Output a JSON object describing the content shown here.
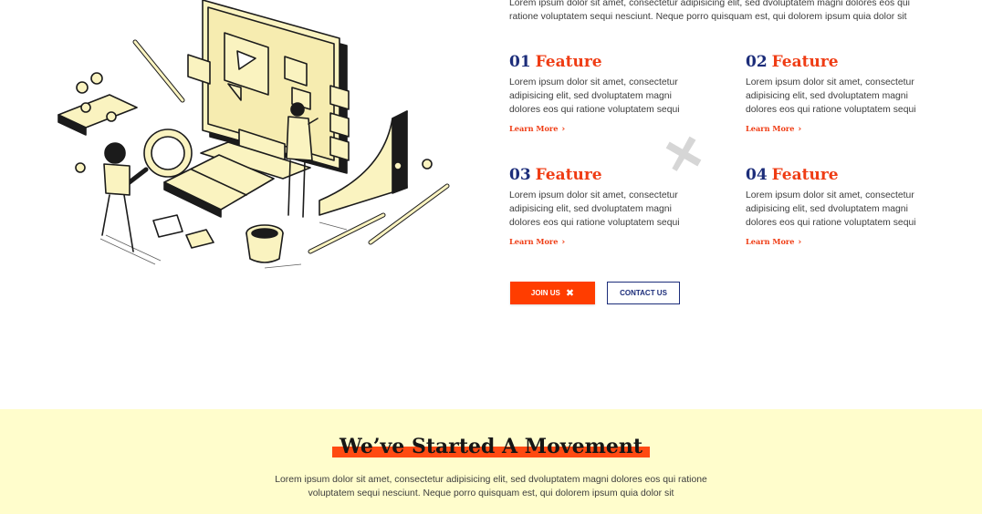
{
  "intro": {
    "text": "Lorem ipsum dolor sit amet, consectetur adipisicing elit, sed dvoluptatem magni dolores eos qui ratione voluptatem sequi nesciunt. Neque porro quisquam est, qui dolorem ipsum quia dolor sit"
  },
  "features": [
    {
      "number": "01",
      "title": "Feature",
      "description": "Lorem ipsum dolor sit amet, consectetur adipisicing elit, sed dvoluptatem magni dolores eos qui ratione voluptatem sequi",
      "link": "Learn More"
    },
    {
      "number": "02",
      "title": "Feature",
      "description": "Lorem ipsum dolor sit amet, consectetur adipisicing elit, sed dvoluptatem magni dolores eos qui ratione voluptatem sequi",
      "link": "Learn More"
    },
    {
      "number": "03",
      "title": "Feature",
      "description": "Lorem ipsum dolor sit amet, consectetur adipisicing elit, sed dvoluptatem magni dolores eos qui ratione voluptatem sequi",
      "link": "Learn More"
    },
    {
      "number": "04",
      "title": "Feature",
      "description": "Lorem ipsum dolor sit amet, consectetur adipisicing elit, sed dvoluptatem magni dolores eos qui ratione voluptatem sequi",
      "link": "Learn More"
    }
  ],
  "buttons": {
    "join": "JOIN US",
    "contact": "CONTACT US"
  },
  "movement": {
    "title": "We’ve Started A Movement",
    "text": "Lorem ipsum dolor sit amet, consectetur adipisicing elit, sed dvoluptatem magni dolores eos qui ratione voluptatem sequi nesciunt. Neque porro quisquam est, qui dolorem ipsum quia dolor sit"
  },
  "colors": {
    "accent": "#ef3c14",
    "navy": "#1c2d7a",
    "band": "#fffdcc",
    "illustration_fill": "#faf3c0"
  },
  "icons": {
    "join": "close-x-icon",
    "link": "chevron-right-icon"
  }
}
